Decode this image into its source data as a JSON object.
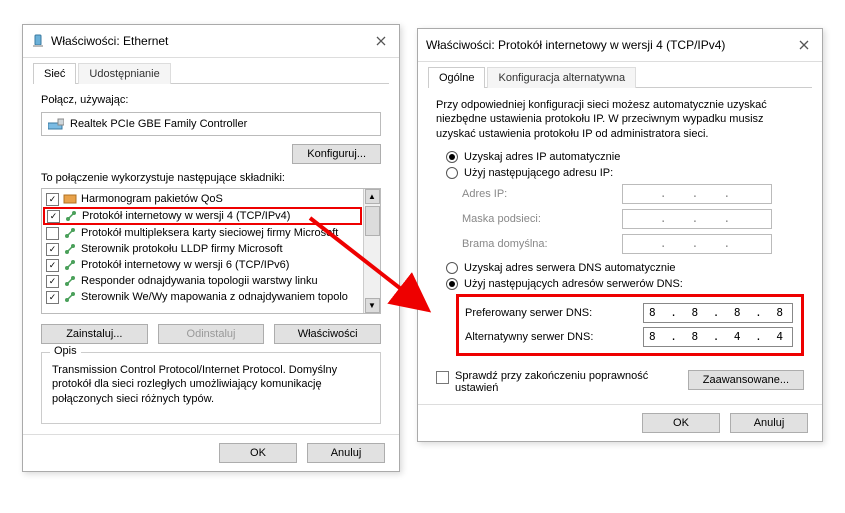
{
  "left": {
    "title": "Właściwości: Ethernet",
    "tabs": {
      "network": "Sieć",
      "sharing": "Udostępnianie"
    },
    "connect_using": "Połącz, używając:",
    "adapter": "Realtek PCIe GBE Family Controller",
    "configure": "Konfiguruj...",
    "uses_components": "To połączenie wykorzystuje następujące składniki:",
    "components": {
      "qos": "Harmonogram pakietów QoS",
      "ipv4": "Protokół internetowy w wersji 4 (TCP/IPv4)",
      "multiplexor": "Protokół multipleksera karty sieciowej firmy Microsoft",
      "lldp": "Sterownik protokołu LLDP firmy Microsoft",
      "ipv6": "Protokół internetowy w wersji 6 (TCP/IPv6)",
      "responder": "Responder odnajdywania topologii warstwy linku",
      "mapper": "Sterownik We/Wy mapowania z odnajdywaniem topolo"
    },
    "install": "Zainstaluj...",
    "uninstall": "Odinstaluj",
    "properties": "Właściwości",
    "desc_header": "Opis",
    "desc_text": "Transmission Control Protocol/Internet Protocol. Domyślny protokół dla sieci rozległych umożliwiający komunikację połączonych sieci różnych typów.",
    "ok": "OK",
    "cancel": "Anuluj"
  },
  "right": {
    "title": "Właściwości: Protokół internetowy w wersji 4 (TCP/IPv4)",
    "tabs": {
      "general": "Ogólne",
      "alt": "Konfiguracja alternatywna"
    },
    "blurb": "Przy odpowiedniej konfiguracji sieci możesz automatycznie uzyskać niezbędne ustawienia protokołu IP. W przeciwnym wypadku musisz uzyskać ustawienia protokołu IP od administratora sieci.",
    "radio_ip_auto": "Uzyskaj adres IP automatycznie",
    "radio_ip_manual": "Użyj następującego adresu IP:",
    "ip_label": "Adres IP:",
    "mask_label": "Maska podsieci:",
    "gw_label": "Brama domyślna:",
    "radio_dns_auto": "Uzyskaj adres serwera DNS automatycznie",
    "radio_dns_manual": "Użyj następujących adresów serwerów DNS:",
    "pref_dns_label": "Preferowany serwer DNS:",
    "alt_dns_label": "Alternatywny serwer DNS:",
    "pref_dns_value": "8 . 8 . 8 . 8",
    "alt_dns_value": "8 . 8 . 4 . 4",
    "validate_label": "Sprawdź przy zakończeniu poprawność ustawień",
    "advanced": "Zaawansowane...",
    "ok": "OK",
    "cancel": "Anuluj"
  }
}
